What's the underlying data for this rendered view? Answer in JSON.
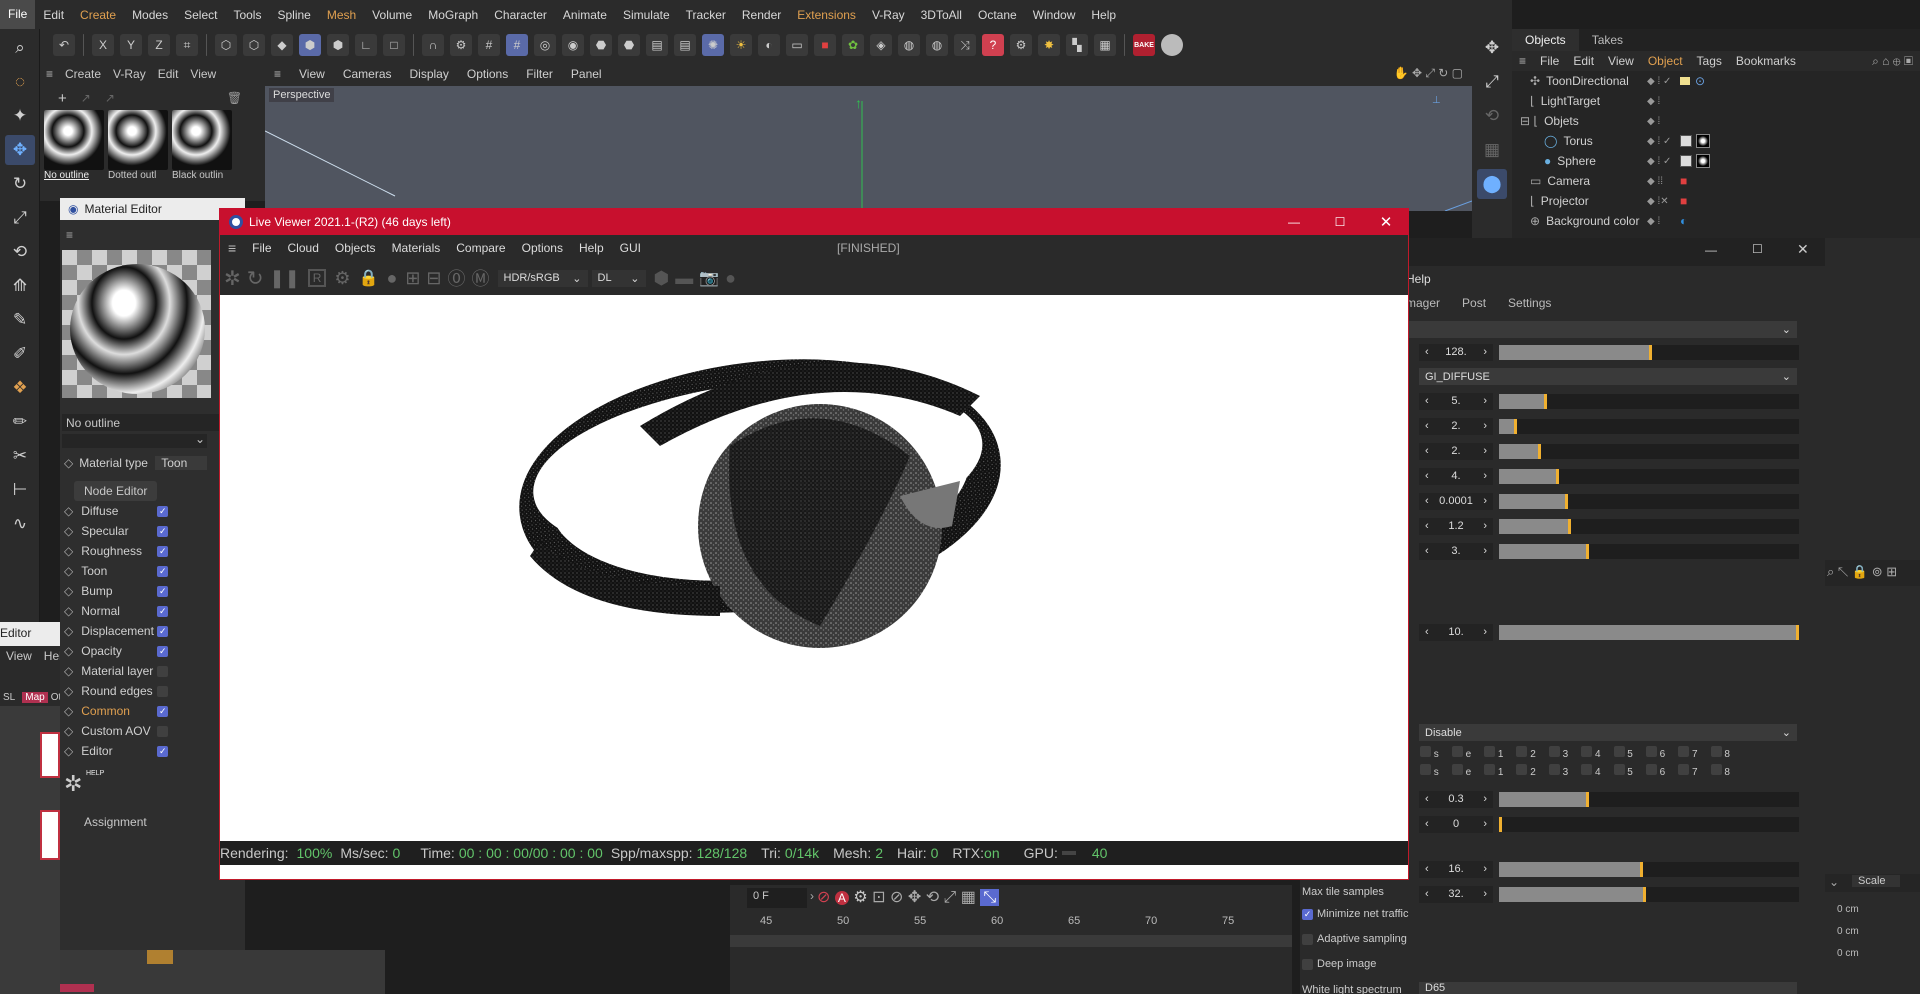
{
  "menubar": {
    "items": [
      "File",
      "Edit",
      "Create",
      "Modes",
      "Select",
      "Tools",
      "Spline",
      "Mesh",
      "Volume",
      "MoGraph",
      "Character",
      "Animate",
      "Simulate",
      "Tracker",
      "Render",
      "Extensions",
      "V-Ray",
      "3DToAll",
      "Octane",
      "Window",
      "Help"
    ]
  },
  "toolbar": {
    "axis_labels": [
      "X",
      "Y",
      "Z"
    ],
    "bake_label": "BAKE"
  },
  "material_manager": {
    "menu": [
      "Create",
      "V-Ray",
      "Edit",
      "View"
    ],
    "swatches": [
      "No outline",
      "Dotted outl",
      "Black outlin"
    ]
  },
  "viewport": {
    "menu": [
      "View",
      "Cameras",
      "Display",
      "Options",
      "Filter",
      "Panel"
    ],
    "label": "Perspective"
  },
  "objects_panel": {
    "tabs": [
      "Objects",
      "Takes"
    ],
    "menu": [
      "File",
      "Edit",
      "View",
      "Object",
      "Tags",
      "Bookmarks"
    ],
    "objects": [
      "ToonDirectional",
      "LightTarget",
      "Objets",
      "Torus",
      "Sphere",
      "Camera",
      "Projector",
      "Background color"
    ]
  },
  "material_editor": {
    "title": "Material Editor",
    "material_name": "No outline",
    "material_type_label": "Material type",
    "material_type_value": "Toon",
    "node_editor_label": "Node Editor",
    "channels": [
      {
        "label": "Diffuse",
        "checked": true
      },
      {
        "label": "Specular",
        "checked": true
      },
      {
        "label": "Roughness",
        "checked": true
      },
      {
        "label": "Toon",
        "checked": true
      },
      {
        "label": "Bump",
        "checked": true
      },
      {
        "label": "Normal",
        "checked": true
      },
      {
        "label": "Displacement",
        "checked": true
      },
      {
        "label": "Opacity",
        "checked": true
      },
      {
        "label": "Material layer",
        "checked": false
      },
      {
        "label": "Round edges",
        "checked": false
      },
      {
        "label": "Common",
        "checked": true
      },
      {
        "label": "Custom AOV",
        "checked": false
      },
      {
        "label": "Editor",
        "checked": true
      }
    ],
    "help_label": "HELP",
    "assignment_label": "Assignment"
  },
  "node_editor": {
    "title": "Editor",
    "menu": [
      "View",
      "Hel"
    ],
    "tabs": [
      "SL",
      "Map",
      "Ot"
    ]
  },
  "live_viewer": {
    "title": "Live Viewer 2021.1-(R2) (46 days left)",
    "menu": [
      "File",
      "Cloud",
      "Objects",
      "Materials",
      "Compare",
      "Options",
      "Help",
      "GUI"
    ],
    "state": "[FINISHED]",
    "color_space": "HDR/sRGB",
    "channel": "DL",
    "status": {
      "rendering_label": "Rendering:",
      "rendering_value": "100%",
      "mssec_label": "Ms/sec:",
      "mssec_value": "0",
      "time_label": "Time:",
      "time_value": "00 : 00 : 00/00 : 00 : 00",
      "spp_label": "Spp/maxspp:",
      "spp_value": "128/128",
      "tri_label": "Tri:",
      "tri_value": "0/14k",
      "mesh_label": "Mesh:",
      "mesh_value": "2",
      "hair_label": "Hair:",
      "hair_value": "0",
      "rtx_label": "RTX:",
      "rtx_value": "on",
      "gpu_label": "GPU:",
      "gpu_value": "40"
    }
  },
  "render_settings": {
    "menu_help": "Help",
    "tabs": [
      "mager",
      "Post",
      "Settings"
    ],
    "rows": [
      {
        "value": "128.",
        "fill": 0.51
      },
      {
        "value": "5.",
        "fill": 0.16
      },
      {
        "value": "2.",
        "fill": 0.06
      },
      {
        "value": "2.",
        "fill": 0.14
      },
      {
        "value": "4.",
        "fill": 0.2
      },
      {
        "value": "0.0001",
        "fill": 0.23
      },
      {
        "value": "1.2",
        "fill": 0.24
      },
      {
        "value": "3.",
        "fill": 0.3
      },
      {
        "value": "10.",
        "fill": 1.0
      },
      {
        "value": "0.3",
        "fill": 0.3
      },
      {
        "value": "0",
        "fill": 0.0
      },
      {
        "value": "16.",
        "fill": 0.48
      },
      {
        "value": "32.",
        "fill": 0.49
      }
    ],
    "gi_mode": "GI_DIFFUSE",
    "disable_label": "Disable",
    "flags": [
      "s",
      "e",
      "1",
      "2",
      "3",
      "4",
      "5",
      "6",
      "7",
      "8"
    ],
    "max_tile_samples_label": "Max tile samples",
    "minimize_net_traffic_label": "Minimize net traffic",
    "adaptive_sampling_label": "Adaptive sampling",
    "deep_image_label": "Deep image",
    "white_light_label": "White light spectrum",
    "white_light_value": "D65"
  },
  "coords": {
    "scale_label": "Scale",
    "values": [
      "0 cm",
      "0 cm",
      "0 cm"
    ]
  },
  "timeline": {
    "frame": "0 F",
    "ticks": [
      "45",
      "50",
      "55",
      "60",
      "65",
      "70",
      "75"
    ]
  }
}
